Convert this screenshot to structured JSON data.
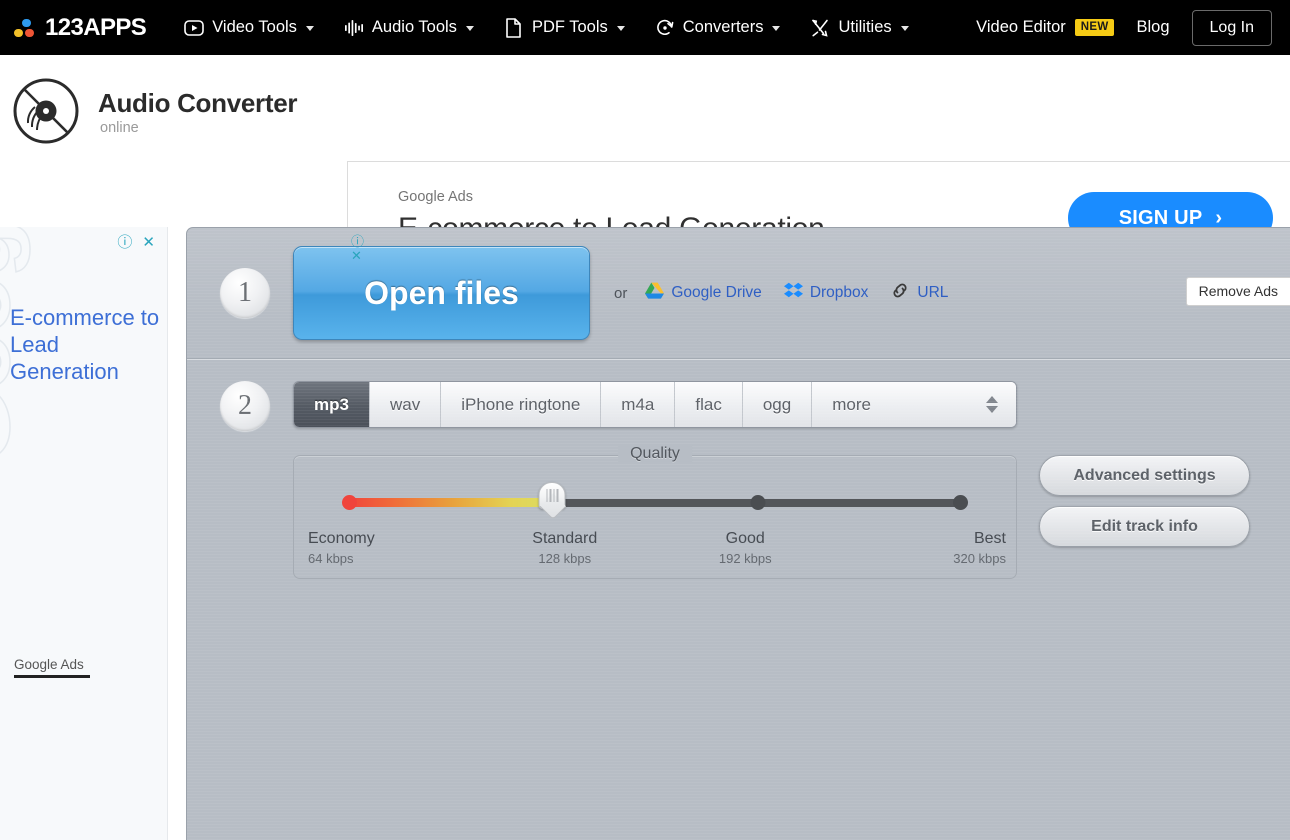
{
  "nav": {
    "brand": "123APPS",
    "items": [
      {
        "label": "Video Tools",
        "icon": "video-play-icon",
        "has_caret": true
      },
      {
        "label": "Audio Tools",
        "icon": "waveform-icon",
        "has_caret": true
      },
      {
        "label": "PDF Tools",
        "icon": "document-icon",
        "has_caret": true
      },
      {
        "label": "Converters",
        "icon": "refresh-circle-icon",
        "has_caret": true
      },
      {
        "label": "Utilities",
        "icon": "tools-cross-icon",
        "has_caret": true
      }
    ],
    "video_editor": "Video Editor",
    "video_editor_badge": "NEW",
    "blog": "Blog",
    "login": "Log In"
  },
  "header": {
    "app_title": "Audio Converter",
    "app_subtitle": "online",
    "icon": "vinyl-record-icon"
  },
  "banner_ad": {
    "kicker": "Google Ads",
    "headline": "E-commerce to Lead Generation",
    "cta": "SIGN UP",
    "cta_arrow": "›",
    "info_mark": "ⓘ",
    "close_mark": "✕",
    "cta_color": "#1a8cff"
  },
  "remove_ads": "Remove Ads",
  "sidebar_ad": {
    "headline": "E-commerce to Lead Generation",
    "footer_label": "Google Ads",
    "watermark": "Google Ads",
    "info_mark": "ⓘ",
    "close_mark": "✕",
    "text_color": "#3d6fd6"
  },
  "step1": {
    "number": "1",
    "open_files": "Open files",
    "or": "or",
    "cloud_links": [
      {
        "label": "Google Drive",
        "icon": "google-drive-icon"
      },
      {
        "label": "Dropbox",
        "icon": "dropbox-icon"
      },
      {
        "label": "URL",
        "icon": "link-chain-icon"
      }
    ]
  },
  "step2": {
    "number": "2",
    "formats": [
      {
        "label": "mp3",
        "active": true
      },
      {
        "label": "wav",
        "active": false
      },
      {
        "label": "iPhone ringtone",
        "active": false
      },
      {
        "label": "m4a",
        "active": false
      },
      {
        "label": "flac",
        "active": false
      },
      {
        "label": "ogg",
        "active": false
      },
      {
        "label": "more",
        "active": false
      }
    ],
    "quality": {
      "legend": "Quality",
      "selected": "Standard",
      "stops": [
        {
          "name": "Economy",
          "rate": "64 kbps"
        },
        {
          "name": "Standard",
          "rate": "128 kbps"
        },
        {
          "name": "Good",
          "rate": "192 kbps"
        },
        {
          "name": "Best",
          "rate": "320 kbps"
        }
      ]
    },
    "buttons": [
      {
        "label": "Advanced settings"
      },
      {
        "label": "Edit track info"
      }
    ]
  }
}
